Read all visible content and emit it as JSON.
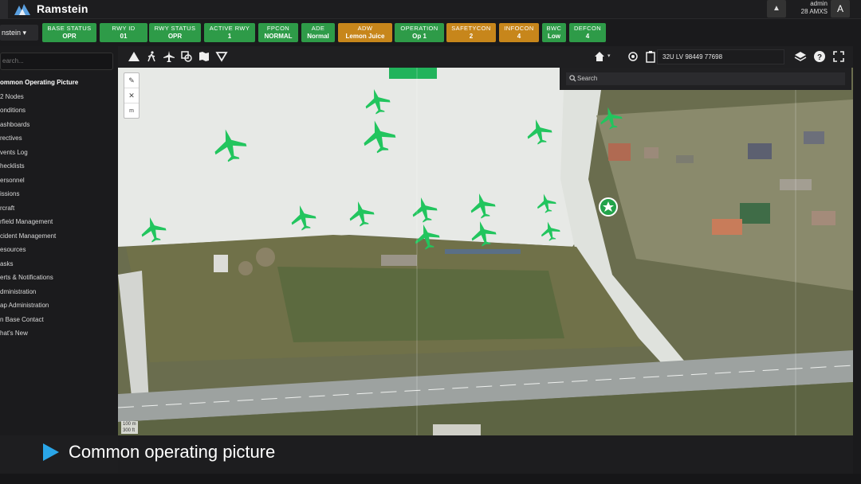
{
  "header": {
    "title": "Ramstein",
    "user_name": "admin",
    "user_unit": "28 AMXS",
    "avatar_letter": "A",
    "collapse_icon": "chevron-up-icon"
  },
  "statusbar": {
    "base_select": "nstein ▾",
    "tiles": [
      {
        "label": "BASE STATUS",
        "value": "OPR",
        "color": "#2e9b48"
      },
      {
        "label": "RWY ID",
        "value": "01",
        "color": "#2e9b48"
      },
      {
        "label": "RWY STATUS",
        "value": "OPR",
        "color": "#2e9b48"
      },
      {
        "label": "ACTIVE RWY",
        "value": "1",
        "color": "#2e9b48"
      },
      {
        "label": "FPCON",
        "value": "NORMAL",
        "color": "#2e9b48"
      },
      {
        "label": "ADE",
        "value": "Normal",
        "color": "#2e9b48"
      },
      {
        "label": "ADW",
        "value": "Lemon Juice",
        "color": "#c7861b"
      },
      {
        "label": "OPERATION",
        "value": "Op 1",
        "color": "#2e9b48"
      },
      {
        "label": "SAFETYCON",
        "value": "2",
        "color": "#c7861b"
      },
      {
        "label": "INFOCON",
        "value": "4",
        "color": "#c7861b"
      },
      {
        "label": "BWC",
        "value": "Low",
        "color": "#2e9b48"
      },
      {
        "label": "DEFCON",
        "value": "4",
        "color": "#2e9b48"
      }
    ]
  },
  "sidebar": {
    "search_placeholder": "earch...",
    "items": [
      "ommon Operating Picture",
      "2 Nodes",
      "onditions",
      "ashboards",
      "rectives",
      "vents Log",
      "hecklists",
      "ersonnel",
      "issions",
      "rcraft",
      "rfield Management",
      "cident Management",
      "esources",
      "asks",
      "erts & Notifications",
      "dministration",
      "ap Administration",
      "n Base Contact",
      "hat's New"
    ]
  },
  "toolbar": {
    "coords": "32U LV 98449 77698"
  },
  "map": {
    "search_placeholder": "Search",
    "scale_m": "100 m",
    "scale_ft": "300 ft"
  },
  "caption": {
    "text": "Common operating picture"
  },
  "colors": {
    "aircraft": "#22c55e",
    "accent": "#2aa6e8"
  }
}
